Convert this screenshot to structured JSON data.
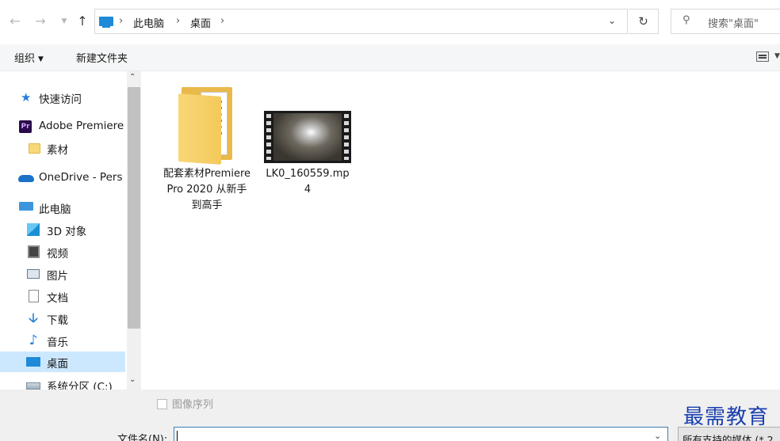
{
  "address_bar": {
    "crumbs": [
      "此电脑",
      "桌面"
    ],
    "search_placeholder": "搜索\"桌面\""
  },
  "toolbar": {
    "organize_label": "组织",
    "new_folder_label": "新建文件夹"
  },
  "sidebar": {
    "items": [
      {
        "label": "快速访问",
        "icon": "star-icon"
      },
      {
        "label": "Adobe Premiere",
        "icon": "premiere-icon"
      },
      {
        "label": "素材",
        "icon": "folder-icon"
      },
      {
        "label": "OneDrive - Pers",
        "icon": "cloud-icon"
      },
      {
        "label": "此电脑",
        "icon": "computer-icon"
      },
      {
        "label": "3D 对象",
        "icon": "cube-icon"
      },
      {
        "label": "视频",
        "icon": "video-icon"
      },
      {
        "label": "图片",
        "icon": "picture-icon"
      },
      {
        "label": "文档",
        "icon": "document-icon"
      },
      {
        "label": "下载",
        "icon": "download-icon"
      },
      {
        "label": "音乐",
        "icon": "music-icon"
      },
      {
        "label": "桌面",
        "icon": "desktop-icon",
        "selected": true
      },
      {
        "label": "系统分区 (C:)",
        "icon": "drive-icon"
      }
    ]
  },
  "content": {
    "files": [
      {
        "name": "配套素材Premiere Pro 2020 从新手到高手",
        "type": "folder"
      },
      {
        "name": "LK0_160559.mp4",
        "type": "video"
      }
    ]
  },
  "bottom": {
    "image_sequence_label": "图像序列",
    "filename_label": "文件名(N):",
    "filename_value": "",
    "file_type_value": "所有支持的媒体 (*.2"
  },
  "watermark": "最需教育",
  "colors": {
    "selected_bg": "#cce8ff",
    "accent": "#1f8ad8",
    "watermark": "#1a3fae"
  }
}
